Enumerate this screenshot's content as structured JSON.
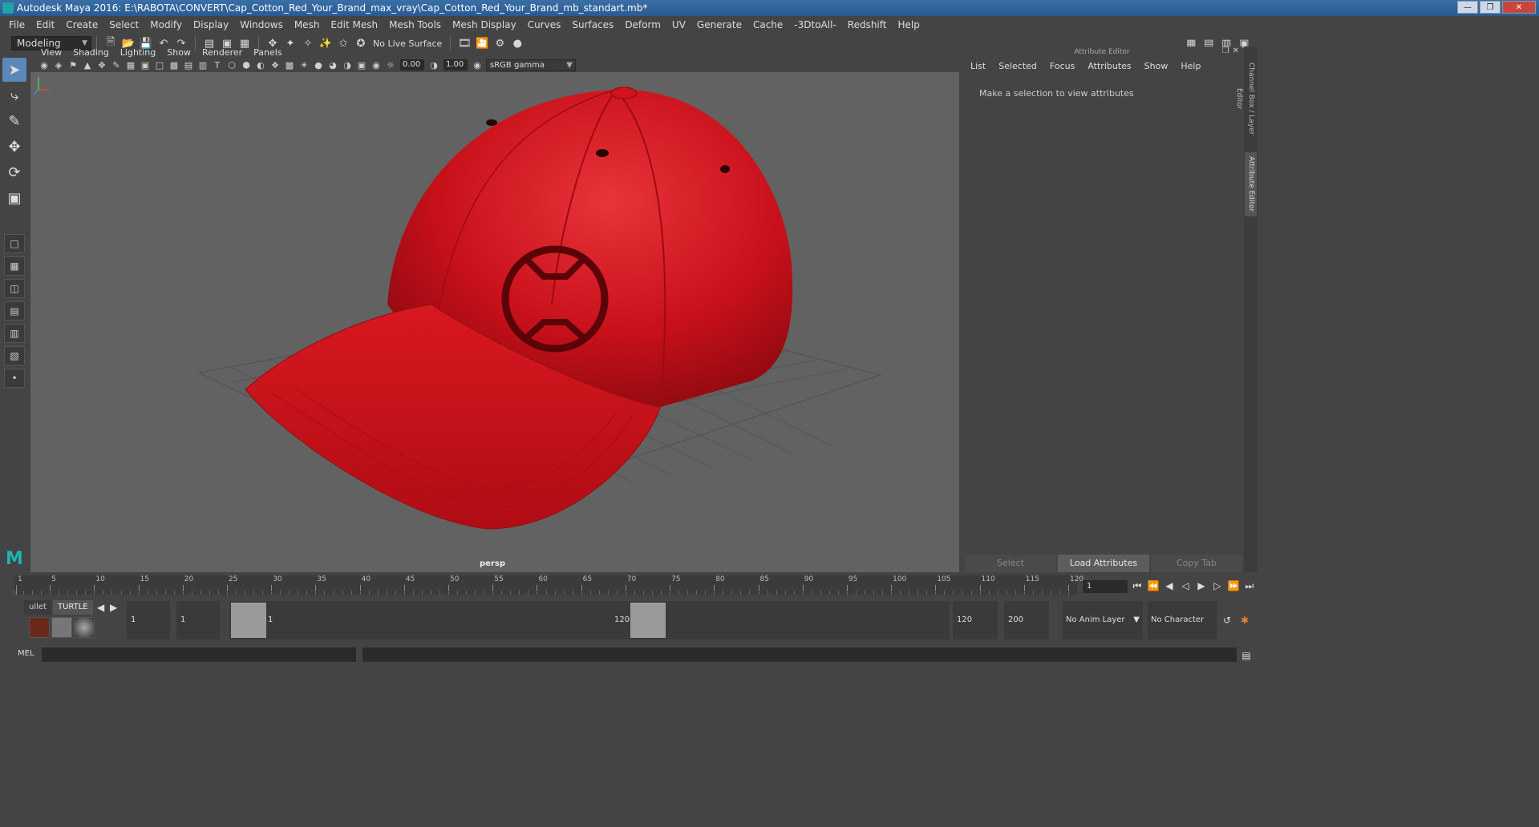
{
  "window": {
    "title": "Autodesk Maya 2016: E:\\RABOTA\\CONVERT\\Cap_Cotton_Red_Your_Brand_max_vray\\Cap_Cotton_Red_Your_Brand_mb_standart.mb*"
  },
  "menubar": {
    "items": [
      "File",
      "Edit",
      "Create",
      "Select",
      "Modify",
      "Display",
      "Windows",
      "Mesh",
      "Edit Mesh",
      "Mesh Tools",
      "Mesh Display",
      "Curves",
      "Surfaces",
      "Deform",
      "UV",
      "Generate",
      "Cache",
      "-3DtoAll-",
      "Redshift",
      "Help"
    ]
  },
  "statusline": {
    "mode": "Modeling",
    "live_surface": "No Live Surface"
  },
  "viewport": {
    "menu": [
      "View",
      "Shading",
      "Lighting",
      "Show",
      "Renderer",
      "Panels"
    ],
    "field_a": "0.00",
    "field_b": "1.00",
    "color_space": "sRGB gamma",
    "camera": "persp",
    "cap_color": "#c8101a",
    "background": "#626262"
  },
  "attribute_editor": {
    "title": "Attribute Editor",
    "menu": [
      "List",
      "Selected",
      "Focus",
      "Attributes",
      "Show",
      "Help"
    ],
    "message": "Make a selection to view attributes",
    "buttons": [
      "Select",
      "Load Attributes",
      "Copy Tab"
    ]
  },
  "side_tabs": {
    "channel_box": "Channel Box / Layer Editor",
    "attribute_editor": "Attribute Editor"
  },
  "timeline": {
    "ticks": [
      "1",
      "5",
      "10",
      "15",
      "20",
      "25",
      "30",
      "35",
      "40",
      "45",
      "50",
      "55",
      "60",
      "65",
      "70",
      "75",
      "80",
      "85",
      "90",
      "95",
      "100",
      "105",
      "110",
      "115",
      "120"
    ],
    "current_frame": "1"
  },
  "range": {
    "shelf_tabs": [
      "ullet",
      "TURTLE"
    ],
    "start": "1",
    "anim_start": "1",
    "slider_start": "1",
    "slider_end": "120",
    "anim_end": "120",
    "end": "200",
    "anim_layer": "No Anim Layer",
    "character_set": "No Character Set"
  },
  "cmdline": {
    "label": "MEL"
  }
}
